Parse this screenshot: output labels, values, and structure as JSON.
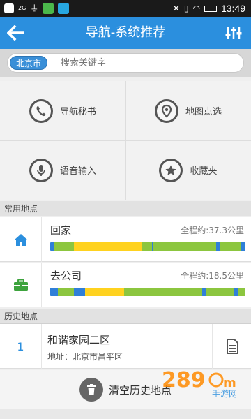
{
  "status_bar": {
    "time": "13:49",
    "signal_text": "2G"
  },
  "header": {
    "title": "导航-系统推荐"
  },
  "search": {
    "city": "北京市",
    "placeholder": "搜索关键字"
  },
  "grid": [
    {
      "label": "导航秘书",
      "icon": "phone-icon"
    },
    {
      "label": "地图点选",
      "icon": "map-pin-icon"
    },
    {
      "label": "语音输入",
      "icon": "microphone-icon"
    },
    {
      "label": "收藏夹",
      "icon": "star-icon"
    }
  ],
  "frequent": {
    "header": "常用地点",
    "items": [
      {
        "name": "回家",
        "distance": "全程约:37.3公里",
        "icon": "home-icon",
        "traffic": [
          {
            "color": "#2f7fd8",
            "share": 0.02
          },
          {
            "color": "#8cc63f",
            "share": 0.1
          },
          {
            "color": "#ffd21f",
            "share": 0.35
          },
          {
            "color": "#8cc63f",
            "share": 0.05
          },
          {
            "color": "#2f7fd8",
            "share": 0.01
          },
          {
            "color": "#8cc63f",
            "share": 0.32
          },
          {
            "color": "#2f7fd8",
            "share": 0.02
          },
          {
            "color": "#8cc63f",
            "share": 0.11
          },
          {
            "color": "#2f7fd8",
            "share": 0.02
          }
        ]
      },
      {
        "name": "去公司",
        "distance": "全程约:18.5公里",
        "icon": "briefcase-icon",
        "traffic": [
          {
            "color": "#2f7fd8",
            "share": 0.04
          },
          {
            "color": "#8cc63f",
            "share": 0.08
          },
          {
            "color": "#2f7fd8",
            "share": 0.06
          },
          {
            "color": "#ffd21f",
            "share": 0.2
          },
          {
            "color": "#8cc63f",
            "share": 0.4
          },
          {
            "color": "#2f7fd8",
            "share": 0.02
          },
          {
            "color": "#8cc63f",
            "share": 0.14
          },
          {
            "color": "#2f7fd8",
            "share": 0.02
          },
          {
            "color": "#8cc63f",
            "share": 0.04
          }
        ]
      }
    ]
  },
  "history": {
    "header": "历史地点",
    "items": [
      {
        "index": "1",
        "name": "和谐家园二区",
        "address": "地址：北京市昌平区"
      }
    ],
    "clear_label": "清空历史地点"
  },
  "colors": {
    "accent": "#2b8fde",
    "green": "#8cc63f",
    "yellow": "#ffd21f",
    "blue_seg": "#2f7fd8"
  }
}
